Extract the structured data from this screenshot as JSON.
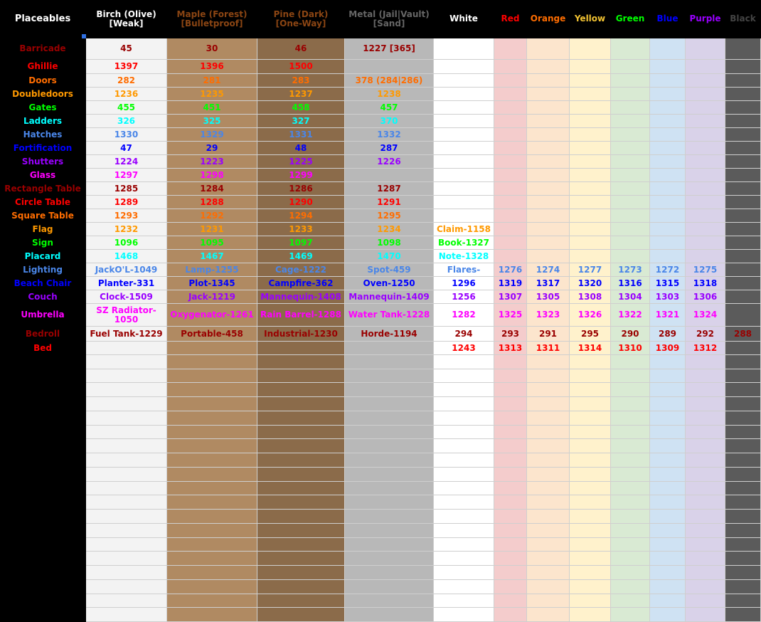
{
  "colors": {
    "bg": {
      "blk": "#000000",
      "w": "#ffffff",
      "br": "#f3f3f3",
      "mp": "#b08a62",
      "pn": "#8b6b4a",
      "mt": "#b8b8b8",
      "rd": "#f4cccc",
      "or": "#fce5cd",
      "ye": "#fff2cc",
      "gr": "#d9ead3",
      "bl": "#cfe2f3",
      "pu": "#d9d2e9",
      "bk": "#5b5b5b"
    },
    "fg": {
      "white": "#ffffff",
      "darkred": "#990000",
      "red": "#ff0000",
      "orange": "#ff6d01",
      "amber": "#ff9900",
      "yellow": "#f1c232",
      "green": "#00ff00",
      "cyan": "#00ffff",
      "blue": "#4a86e8",
      "deepblue": "#0000ff",
      "violet": "#9900ff",
      "magenta": "#ff00ff",
      "brown": "#8b4513",
      "gray": "#666666",
      "dgray": "#444444"
    }
  },
  "header": {
    "title": "Placeables",
    "columns": [
      {
        "label": "Birch (Olive)\n[Weak]",
        "color": "white",
        "bg": "blk"
      },
      {
        "label": "Maple (Forest)\n[Bulletproof]",
        "color": "brown",
        "bg": "blk"
      },
      {
        "label": "Pine (Dark)\n[One-Way]",
        "color": "brown",
        "bg": "blk"
      },
      {
        "label": "Metal (Jail|Vault)\n[Sand]",
        "color": "gray",
        "bg": "blk"
      },
      {
        "label": "White",
        "color": "white",
        "bg": "blk"
      },
      {
        "label": "Red",
        "color": "red",
        "bg": "blk"
      },
      {
        "label": "Orange",
        "color": "orange",
        "bg": "blk"
      },
      {
        "label": "Yellow",
        "color": "yellow",
        "bg": "blk"
      },
      {
        "label": "Green",
        "color": "green",
        "bg": "blk"
      },
      {
        "label": "Blue",
        "color": "deepblue",
        "bg": "blk"
      },
      {
        "label": "Purple",
        "color": "violet",
        "bg": "blk"
      },
      {
        "label": "Black",
        "color": "dgray",
        "bg": "blk"
      }
    ]
  },
  "rows": [
    {
      "label": "Barricade",
      "color": "darkred",
      "cells": [
        "45",
        "30",
        "46",
        "1227 [365]",
        "",
        "",
        "",
        "",
        "",
        "",
        "",
        ""
      ]
    },
    {
      "label": "Ghillie",
      "color": "red",
      "cells": [
        "1397",
        "1396",
        "1500",
        "",
        "",
        "",
        "",
        "",
        "",
        "",
        "",
        ""
      ]
    },
    {
      "label": "Doors",
      "color": "orange",
      "cells": [
        "282",
        "281",
        "283",
        "378 (284|286)",
        "",
        "",
        "",
        "",
        "",
        "",
        "",
        ""
      ]
    },
    {
      "label": "Doubledoors",
      "color": "amber",
      "cells": [
        "1236",
        "1235",
        "1237",
        "1238",
        "",
        "",
        "",
        "",
        "",
        "",
        "",
        ""
      ]
    },
    {
      "label": "Gates",
      "color": "green",
      "cells": [
        "455",
        "451",
        "458",
        "457",
        "",
        "",
        "",
        "",
        "",
        "",
        "",
        ""
      ]
    },
    {
      "label": "Ladders",
      "color": "cyan",
      "cells": [
        "326",
        "325",
        "327",
        "370",
        "",
        "",
        "",
        "",
        "",
        "",
        "",
        ""
      ]
    },
    {
      "label": "Hatches",
      "color": "blue",
      "cells": [
        "1330",
        "1329",
        "1331",
        "1332",
        "",
        "",
        "",
        "",
        "",
        "",
        "",
        ""
      ]
    },
    {
      "label": "Fortification",
      "color": "deepblue",
      "cells": [
        "47",
        "29",
        "48",
        "287",
        "",
        "",
        "",
        "",
        "",
        "",
        "",
        ""
      ]
    },
    {
      "label": "Shutters",
      "color": "violet",
      "cells": [
        "1224",
        "1223",
        "1225",
        "1226",
        "",
        "",
        "",
        "",
        "",
        "",
        "",
        ""
      ]
    },
    {
      "label": "Glass",
      "color": "magenta",
      "cells": [
        "1297",
        "1298",
        "1299",
        "",
        "",
        "",
        "",
        "",
        "",
        "",
        "",
        ""
      ]
    },
    {
      "label": "Rectangle Table",
      "color": "darkred",
      "cells": [
        "1285",
        "1284",
        "1286",
        "1287",
        "",
        "",
        "",
        "",
        "",
        "",
        "",
        ""
      ]
    },
    {
      "label": "Circle Table",
      "color": "red",
      "cells": [
        "1289",
        "1288",
        "1290",
        "1291",
        "",
        "",
        "",
        "",
        "",
        "",
        "",
        ""
      ]
    },
    {
      "label": "Square Table",
      "color": "orange",
      "cells": [
        "1293",
        "1292",
        "1294",
        "1295",
        "",
        "",
        "",
        "",
        "",
        "",
        "",
        ""
      ]
    },
    {
      "label": "Flag",
      "color": "amber",
      "cells": [
        "1232",
        "1231",
        "1233",
        "1234",
        "Claim-1158",
        "",
        "",
        "",
        "",
        "",
        "",
        ""
      ]
    },
    {
      "label": "Sign",
      "color": "green",
      "cells": [
        "1096",
        "1095",
        "1097",
        "1098",
        "Book-1327",
        "",
        "",
        "",
        "",
        "",
        "",
        ""
      ]
    },
    {
      "label": "Placard",
      "color": "cyan",
      "cells": [
        "1468",
        "1467",
        "1469",
        "1470",
        "Note-1328",
        "",
        "",
        "",
        "",
        "",
        "",
        ""
      ]
    },
    {
      "label": "Lighting",
      "color": "blue",
      "cells": [
        "JackO'L-1049",
        "Lamp-1255",
        "Cage-1222",
        "Spot-459",
        "Flares-",
        "1276",
        "1274",
        "1277",
        "1273",
        "1272",
        "1275",
        ""
      ]
    },
    {
      "label": "Beach Chair",
      "color": "deepblue",
      "cells": [
        "Planter-331",
        "Plot-1345",
        "Campfire-362",
        "Oven-1250",
        "1296",
        "1319",
        "1317",
        "1320",
        "1316",
        "1315",
        "1318",
        ""
      ]
    },
    {
      "label": "Couch",
      "color": "violet",
      "cells": [
        "Clock-1509",
        "Jack-1219",
        "Mannequin-1408",
        "Mannequin-1409",
        "1256",
        "1307",
        "1305",
        "1308",
        "1304",
        "1303",
        "1306",
        ""
      ]
    },
    {
      "label": "Umbrella",
      "color": "magenta",
      "cells": [
        "SZ Radiator-1050",
        "Oxygenator-1261",
        "Rain Barrel-1288",
        "Water Tank-1228",
        "1282",
        "1325",
        "1323",
        "1326",
        "1322",
        "1321",
        "1324",
        ""
      ]
    },
    {
      "label": "Bedroll",
      "color": "darkred",
      "cells": [
        "Fuel Tank-1229",
        "Portable-458",
        "Industrial-1230",
        "Horde-1194",
        "294",
        "293",
        "291",
        "295",
        "290",
        "289",
        "292",
        "288"
      ]
    },
    {
      "label": "Bed",
      "color": "red",
      "cells": [
        "",
        "",
        "",
        "",
        "1243",
        "1313",
        "1311",
        "1314",
        "1310",
        "1309",
        "1312",
        ""
      ]
    }
  ],
  "empty_rows": 19
}
